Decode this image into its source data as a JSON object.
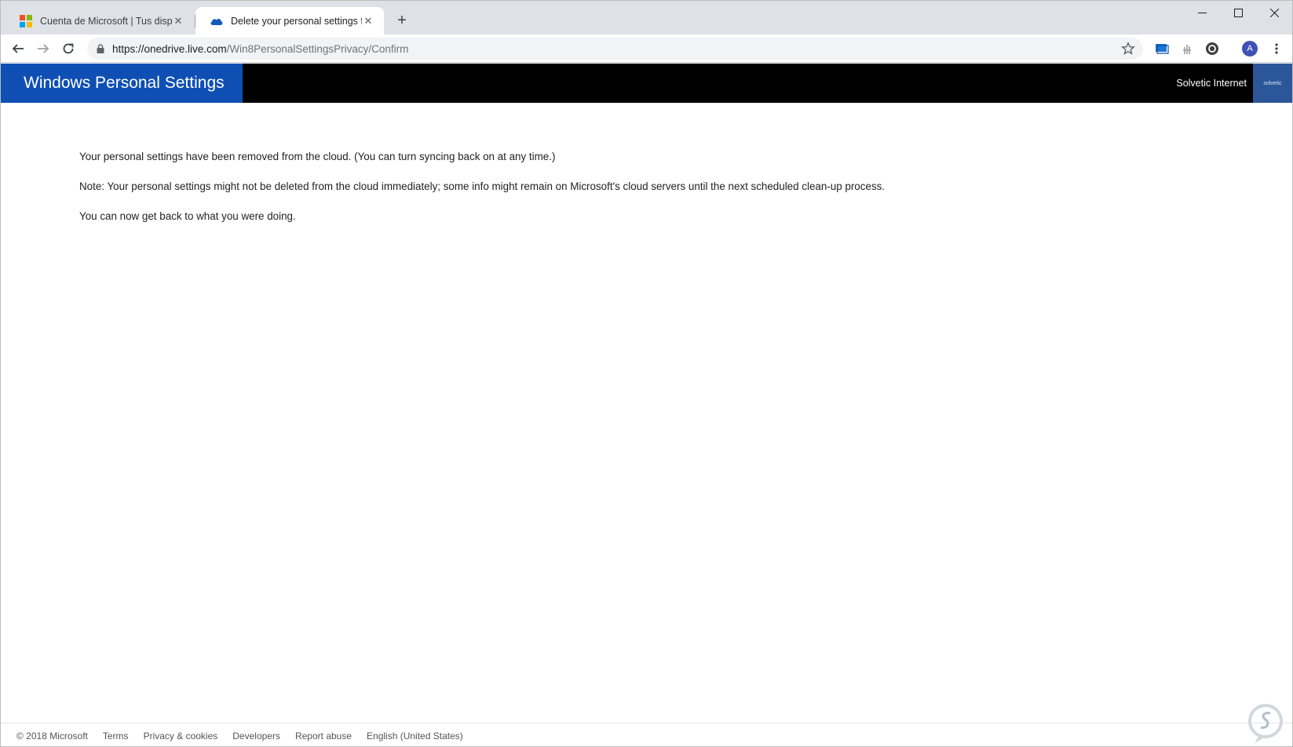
{
  "browser": {
    "tabs": [
      {
        "title": "Cuenta de Microsoft | Tus dispositivos",
        "active": false,
        "icon": "microsoft-logo-icon"
      },
      {
        "title": "Delete your personal settings from the cloud",
        "active": true,
        "icon": "onedrive-cloud-icon"
      }
    ],
    "url_host": "https://onedrive.live.com",
    "url_path": "/Win8PersonalSettingsPrivacy/Confirm",
    "profile_initial": "A",
    "colors": {
      "tabstrip": "#dee1e6",
      "omnibox": "#f1f3f4",
      "avatar": "#3f51b5"
    }
  },
  "header": {
    "brand": "Windows Personal Settings",
    "user_name": "Solvetic Internet",
    "user_pic_text": "solvetic",
    "colors": {
      "brand_bg": "#0f4fb4",
      "bar_bg": "#000000",
      "userpic_bg": "#2b579a"
    }
  },
  "content": {
    "line1": "Your personal settings have been removed from the cloud. (You can turn syncing back on at any time.)",
    "line2": "Note: Your personal settings might not be deleted from the cloud immediately; some info might remain on Microsoft's cloud servers until the next scheduled clean-up process.",
    "line3": "You can now get back to what you were doing."
  },
  "footer": {
    "copyright": "© 2018 Microsoft",
    "links": [
      "Terms",
      "Privacy & cookies",
      "Developers",
      "Report abuse",
      "English (United States)"
    ]
  }
}
